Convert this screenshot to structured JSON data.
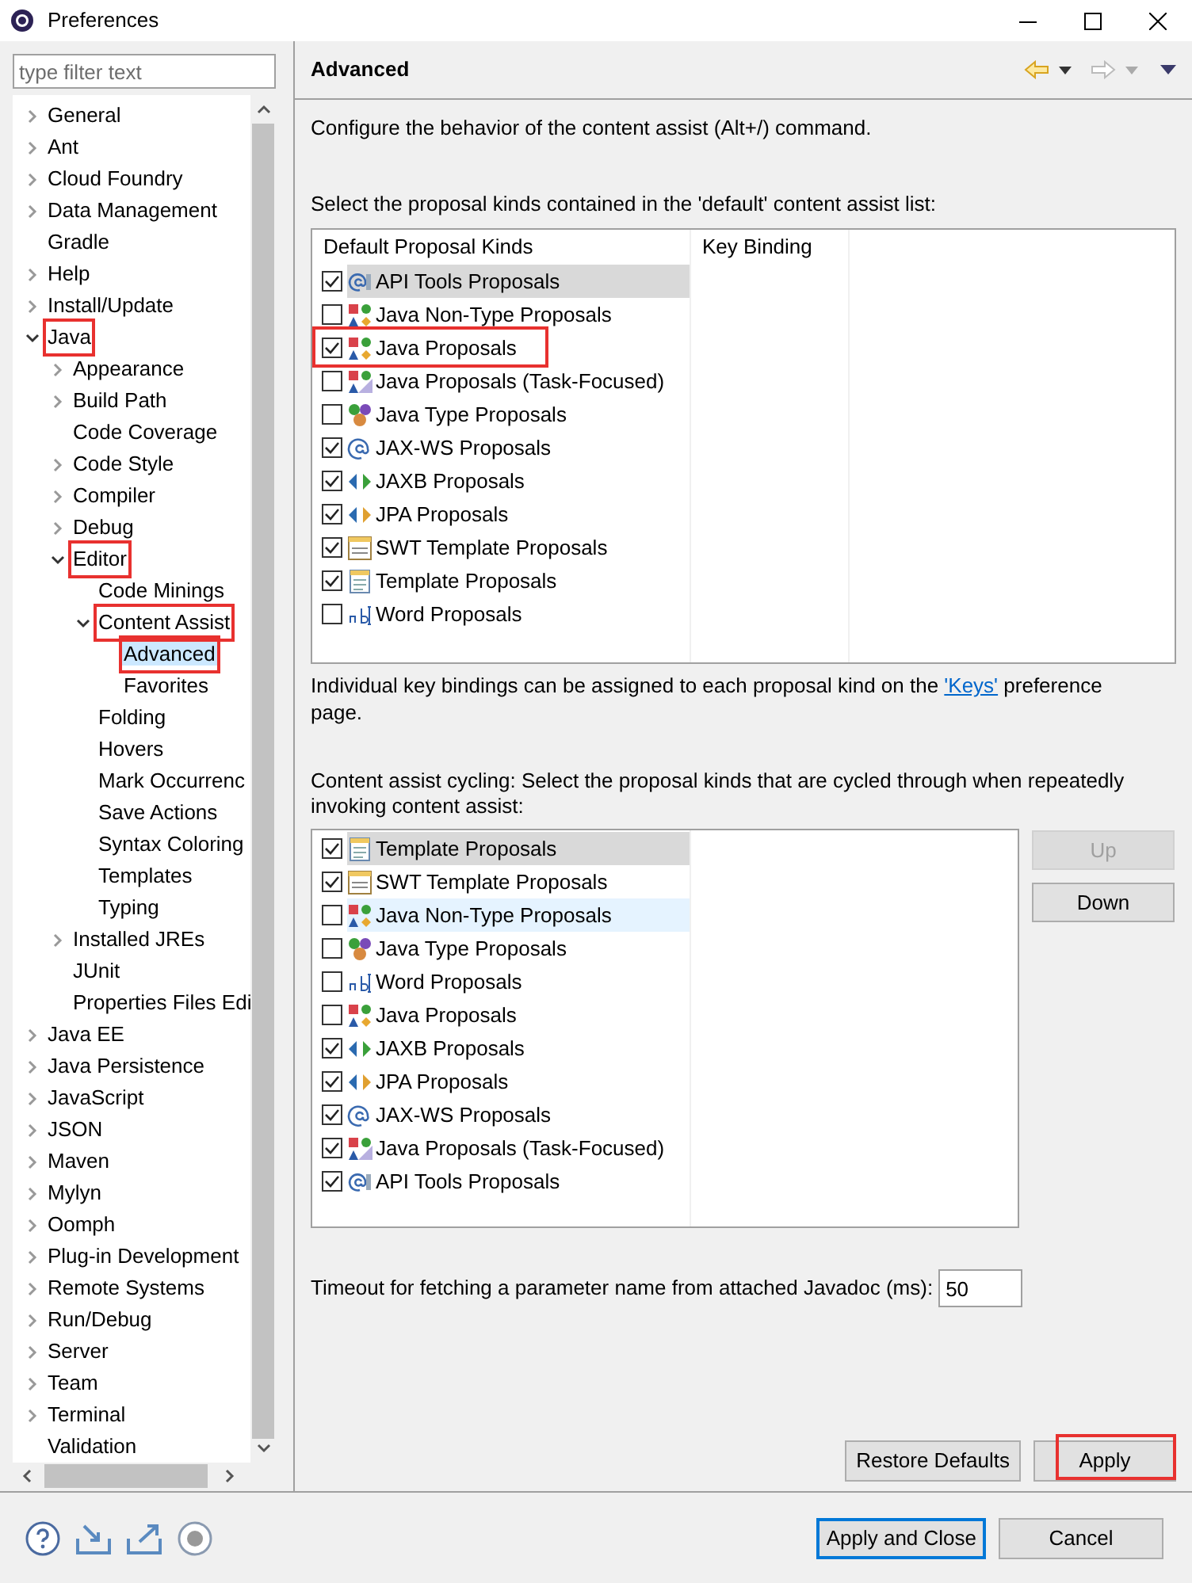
{
  "window": {
    "title": "Preferences"
  },
  "filter": {
    "placeholder": "type filter text"
  },
  "tree": [
    {
      "label": "General",
      "kind": "node",
      "expanded": false,
      "selected": false,
      "marked": false
    },
    {
      "label": "Ant",
      "kind": "node",
      "expanded": false,
      "selected": false,
      "marked": false
    },
    {
      "label": "Cloud Foundry",
      "kind": "node",
      "expanded": false,
      "selected": false,
      "marked": false
    },
    {
      "label": "Data Management",
      "kind": "node",
      "expanded": false,
      "selected": false,
      "marked": false
    },
    {
      "label": "Gradle",
      "kind": "leaf",
      "selected": false,
      "marked": false
    },
    {
      "label": "Help",
      "kind": "node",
      "expanded": false,
      "selected": false,
      "marked": false
    },
    {
      "label": "Install/Update",
      "kind": "node",
      "expanded": false,
      "selected": false,
      "marked": false
    },
    {
      "label": "Java",
      "kind": "node",
      "expanded": true,
      "selected": false,
      "marked": true,
      "children": [
        {
          "label": "Appearance",
          "kind": "node",
          "expanded": false,
          "selected": false,
          "marked": false
        },
        {
          "label": "Build Path",
          "kind": "node",
          "expanded": false,
          "selected": false,
          "marked": false
        },
        {
          "label": "Code Coverage",
          "kind": "leaf",
          "selected": false,
          "marked": false
        },
        {
          "label": "Code Style",
          "kind": "node",
          "expanded": false,
          "selected": false,
          "marked": false
        },
        {
          "label": "Compiler",
          "kind": "node",
          "expanded": false,
          "selected": false,
          "marked": false
        },
        {
          "label": "Debug",
          "kind": "node",
          "expanded": false,
          "selected": false,
          "marked": false
        },
        {
          "label": "Editor",
          "kind": "node",
          "expanded": true,
          "selected": false,
          "marked": true,
          "children": [
            {
              "label": "Code Minings",
              "kind": "leaf",
              "selected": false,
              "marked": false
            },
            {
              "label": "Content Assist",
              "kind": "node",
              "expanded": true,
              "selected": false,
              "marked": true,
              "children": [
                {
                  "label": "Advanced",
                  "kind": "leaf",
                  "selected": true,
                  "marked": true
                },
                {
                  "label": "Favorites",
                  "kind": "leaf",
                  "selected": false,
                  "marked": false
                }
              ]
            },
            {
              "label": "Folding",
              "kind": "leaf",
              "selected": false,
              "marked": false
            },
            {
              "label": "Hovers",
              "kind": "leaf",
              "selected": false,
              "marked": false
            },
            {
              "label": "Mark Occurrenc",
              "kind": "leaf",
              "selected": false,
              "marked": false
            },
            {
              "label": "Save Actions",
              "kind": "leaf",
              "selected": false,
              "marked": false
            },
            {
              "label": "Syntax Coloring",
              "kind": "leaf",
              "selected": false,
              "marked": false
            },
            {
              "label": "Templates",
              "kind": "leaf",
              "selected": false,
              "marked": false
            },
            {
              "label": "Typing",
              "kind": "leaf",
              "selected": false,
              "marked": false
            }
          ]
        },
        {
          "label": "Installed JREs",
          "kind": "node",
          "expanded": false,
          "selected": false,
          "marked": false
        },
        {
          "label": "JUnit",
          "kind": "leaf",
          "selected": false,
          "marked": false
        },
        {
          "label": "Properties Files Edi",
          "kind": "leaf",
          "selected": false,
          "marked": false
        }
      ]
    },
    {
      "label": "Java EE",
      "kind": "node",
      "expanded": false,
      "selected": false,
      "marked": false
    },
    {
      "label": "Java Persistence",
      "kind": "node",
      "expanded": false,
      "selected": false,
      "marked": false
    },
    {
      "label": "JavaScript",
      "kind": "node",
      "expanded": false,
      "selected": false,
      "marked": false
    },
    {
      "label": "JSON",
      "kind": "node",
      "expanded": false,
      "selected": false,
      "marked": false
    },
    {
      "label": "Maven",
      "kind": "node",
      "expanded": false,
      "selected": false,
      "marked": false
    },
    {
      "label": "Mylyn",
      "kind": "node",
      "expanded": false,
      "selected": false,
      "marked": false
    },
    {
      "label": "Oomph",
      "kind": "node",
      "expanded": false,
      "selected": false,
      "marked": false
    },
    {
      "label": "Plug-in Development",
      "kind": "node",
      "expanded": false,
      "selected": false,
      "marked": false
    },
    {
      "label": "Remote Systems",
      "kind": "node",
      "expanded": false,
      "selected": false,
      "marked": false
    },
    {
      "label": "Run/Debug",
      "kind": "node",
      "expanded": false,
      "selected": false,
      "marked": false
    },
    {
      "label": "Server",
      "kind": "node",
      "expanded": false,
      "selected": false,
      "marked": false
    },
    {
      "label": "Team",
      "kind": "node",
      "expanded": false,
      "selected": false,
      "marked": false
    },
    {
      "label": "Terminal",
      "kind": "node",
      "expanded": false,
      "selected": false,
      "marked": false
    },
    {
      "label": "Validation",
      "kind": "leaf",
      "selected": false,
      "marked": false
    }
  ],
  "page": {
    "title": "Advanced",
    "description": "Configure the behavior of the content assist (Alt+/) command.",
    "default_list_label": "Select the proposal kinds contained in the 'default' content assist list:",
    "default_table": {
      "columns": [
        "Default Proposal Kinds",
        "Key Binding"
      ],
      "rows": [
        {
          "label": "API Tools Proposals",
          "kind": "api",
          "checked": true,
          "selected": true,
          "hovered": false,
          "marked": false
        },
        {
          "label": "Java Non-Type Proposals",
          "kind": "java",
          "checked": false,
          "selected": false,
          "hovered": false,
          "marked": false
        },
        {
          "label": "Java Proposals",
          "kind": "java",
          "checked": true,
          "selected": false,
          "hovered": false,
          "marked": true
        },
        {
          "label": "Java Proposals (Task-Focused)",
          "kind": "java-task",
          "checked": false,
          "selected": false,
          "hovered": false,
          "marked": false
        },
        {
          "label": "Java Type Proposals",
          "kind": "java-type",
          "checked": false,
          "selected": false,
          "hovered": false,
          "marked": false
        },
        {
          "label": "JAX-WS Proposals",
          "kind": "at",
          "checked": true,
          "selected": false,
          "hovered": false,
          "marked": false
        },
        {
          "label": "JAXB Proposals",
          "kind": "jaxb",
          "checked": true,
          "selected": false,
          "hovered": false,
          "marked": false
        },
        {
          "label": "JPA Proposals",
          "kind": "jpa",
          "checked": true,
          "selected": false,
          "hovered": false,
          "marked": false
        },
        {
          "label": "SWT Template Proposals",
          "kind": "swt",
          "checked": true,
          "selected": false,
          "hovered": false,
          "marked": false
        },
        {
          "label": "Template Proposals",
          "kind": "template",
          "checked": true,
          "selected": false,
          "hovered": false,
          "marked": false
        },
        {
          "label": "Word Proposals",
          "kind": "word",
          "checked": false,
          "selected": false,
          "hovered": false,
          "marked": false
        }
      ]
    },
    "keys_note_before": "Individual key bindings can be assigned to each proposal kind on the",
    "keys_link": "'Keys'",
    "keys_note_after": "preference page.",
    "cycling_label": "Content assist cycling: Select the proposal kinds that are cycled through when repeatedly invoking content assist:",
    "cycling_table": {
      "rows": [
        {
          "label": "Template Proposals",
          "kind": "template",
          "checked": true,
          "selected": true,
          "hovered": false,
          "marked": false
        },
        {
          "label": "SWT Template Proposals",
          "kind": "swt",
          "checked": true,
          "selected": false,
          "hovered": false,
          "marked": false
        },
        {
          "label": "Java Non-Type Proposals",
          "kind": "java",
          "checked": false,
          "selected": false,
          "hovered": true,
          "marked": false
        },
        {
          "label": "Java Type Proposals",
          "kind": "java-type",
          "checked": false,
          "selected": false,
          "hovered": false,
          "marked": false
        },
        {
          "label": "Word Proposals",
          "kind": "word",
          "checked": false,
          "selected": false,
          "hovered": false,
          "marked": false
        },
        {
          "label": "Java Proposals",
          "kind": "java",
          "checked": false,
          "selected": false,
          "hovered": false,
          "marked": false
        },
        {
          "label": "JAXB Proposals",
          "kind": "jaxb",
          "checked": true,
          "selected": false,
          "hovered": false,
          "marked": false
        },
        {
          "label": "JPA Proposals",
          "kind": "jpa",
          "checked": true,
          "selected": false,
          "hovered": false,
          "marked": false
        },
        {
          "label": "JAX-WS Proposals",
          "kind": "at",
          "checked": true,
          "selected": false,
          "hovered": false,
          "marked": false
        },
        {
          "label": "Java Proposals (Task-Focused)",
          "kind": "java-task",
          "checked": true,
          "selected": false,
          "hovered": false,
          "marked": false
        },
        {
          "label": "API Tools Proposals",
          "kind": "api",
          "checked": true,
          "selected": false,
          "hovered": false,
          "marked": false
        }
      ],
      "buttons": [
        {
          "label": "Up",
          "disabled": true
        },
        {
          "label": "Down",
          "disabled": false
        }
      ]
    },
    "timeout_label": "Timeout for fetching a parameter name from attached Javadoc (ms):",
    "timeout_value": "50",
    "buttons": [
      {
        "label": "Restore Defaults",
        "marked": false
      },
      {
        "label": "Apply",
        "marked": true
      }
    ]
  },
  "footer_buttons": [
    {
      "label": "Apply and Close",
      "default": true
    },
    {
      "label": "Cancel",
      "default": false
    }
  ]
}
